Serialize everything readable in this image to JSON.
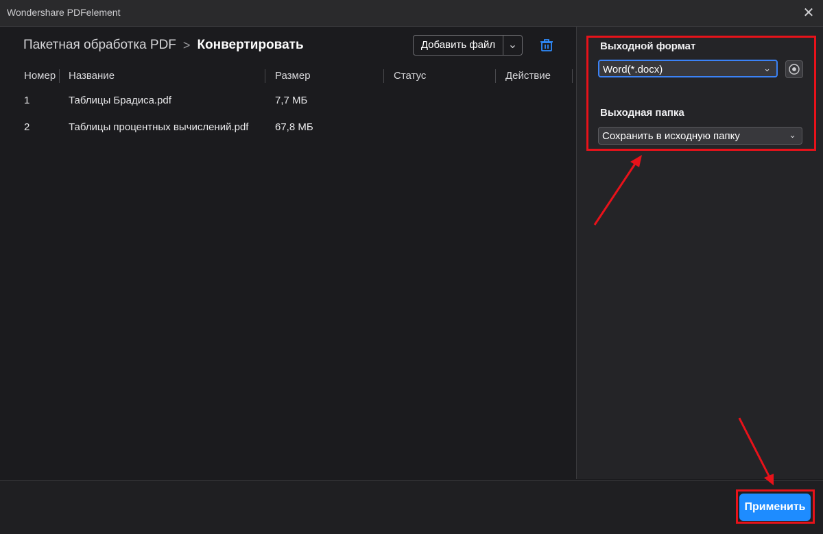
{
  "window": {
    "title": "Wondershare PDFelement",
    "close_glyph": "✕"
  },
  "breadcrumb": {
    "root": "Пакетная обработка PDF",
    "separator": ">",
    "current": "Конвертировать"
  },
  "toolbar": {
    "add_file_label": "Добавить файл",
    "dropdown_glyph": "⌄",
    "delete_icon": "trash-icon"
  },
  "table": {
    "headers": {
      "number": "Номер",
      "name": "Название",
      "size": "Размер",
      "status": "Статус",
      "action": "Действие"
    },
    "rows": [
      {
        "number": "1",
        "name": "Таблицы Брадиса.pdf",
        "size": "7,7 МБ",
        "status": "",
        "action": ""
      },
      {
        "number": "2",
        "name": "Таблицы процентных вычислений.pdf",
        "size": "67,8 МБ",
        "status": "",
        "action": ""
      }
    ]
  },
  "settings": {
    "output_format_label": "Выходной формат",
    "output_format_value": "Word(*.docx)",
    "output_folder_label": "Выходная папка",
    "output_folder_value": "Сохранить в исходную папку",
    "chevron_glyph": "⌄",
    "format_settings_icon": "settings-circle-icon"
  },
  "footer": {
    "apply_label": "Применить"
  },
  "colors": {
    "accent": "#1e8cff",
    "highlight": "#e8121a",
    "background": "#1b1b1e",
    "panel": "#242427"
  }
}
